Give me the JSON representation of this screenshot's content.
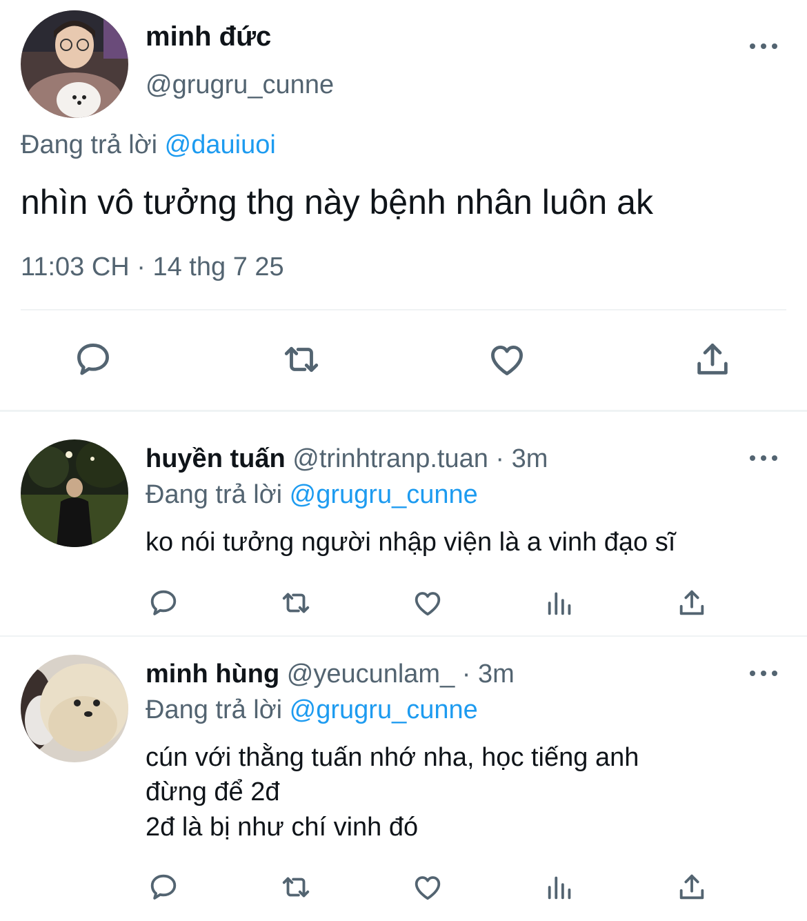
{
  "main_tweet": {
    "author_name": "minh đức",
    "handle": "@grugru_cunne",
    "replying_prefix": "Đang trả lời",
    "replying_to": "@dauiuoi",
    "text": "nhìn vô tưởng thg này bệnh nhân luôn ak",
    "timestamp": "11:03 CH · 14 thg 7 25"
  },
  "replies": [
    {
      "author_name": "huyền tuấn",
      "handle_meta": "@trinhtranp.tuan · 3m",
      "replying_prefix": "Đang trả lời",
      "replying_to": "@grugru_cunne",
      "text_lines": [
        "ko nói tưởng người nhập viện là a vinh đạo sĩ"
      ]
    },
    {
      "author_name": "minh hùng",
      "handle_meta": "@yeucunlam_ · 3m",
      "replying_prefix": "Đang trả lời",
      "replying_to": "@grugru_cunne",
      "text_lines": [
        "cún với thằng tuấn nhớ nha, học tiếng anh",
        "đừng để 2đ",
        "2đ là bị như chí vinh đó"
      ]
    }
  ],
  "icons": {
    "reply": "speech-bubble-icon",
    "retweet": "retweet-icon",
    "like": "heart-icon",
    "views": "bar-chart-icon",
    "share": "share-upload-icon",
    "more": "more-dots-icon"
  },
  "colors": {
    "link": "#1d9bf0",
    "secondary_text": "#536471",
    "primary_text": "#0f1419",
    "divider": "#eff3f4"
  }
}
